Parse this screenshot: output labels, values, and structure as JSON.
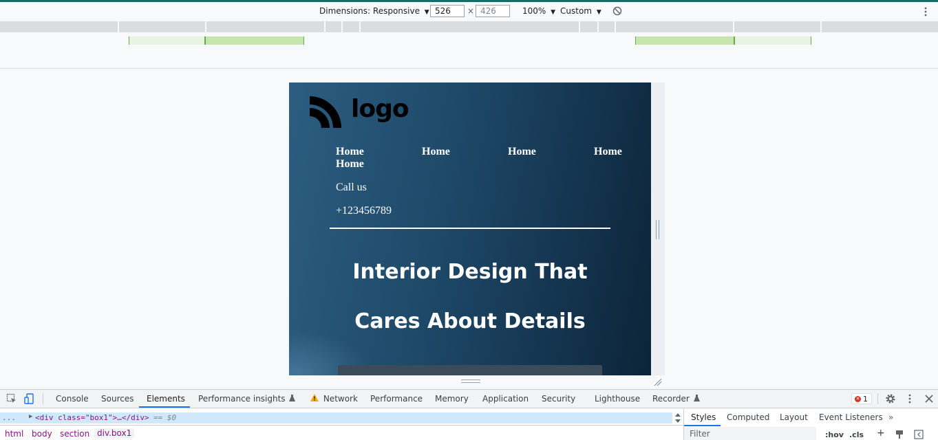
{
  "device_toolbar": {
    "dimensions_label": "Dimensions: Responsive",
    "width_value": "526",
    "height_placeholder": "426",
    "times": "×",
    "zoom_label": "100%",
    "throttle_label": "Custom",
    "dropdown_caret": "▼",
    "more_icon": "kebab-vertical",
    "rotate_icon": "rotate-disabled"
  },
  "site": {
    "logo_text": "logo",
    "nav": [
      "Home",
      "Home",
      "Home",
      "Home",
      "Home"
    ],
    "call_label": "Call us",
    "phone": "+123456789",
    "hero_line1": "Interior Design That",
    "hero_line2": "Cares About Details"
  },
  "devtools": {
    "tabs": [
      "Console",
      "Sources",
      "Elements",
      "Performance insights",
      "Network",
      "Performance",
      "Memory",
      "Application",
      "Security",
      "Lighthouse",
      "Recorder"
    ],
    "active_tab": "Elements",
    "error_count": "1",
    "selected_node": {
      "ellipsis": "...",
      "open": "<div class=\"box1\">…</div>",
      "eq": "== $0"
    },
    "breadcrumbs": [
      "html",
      "body",
      "section",
      "div.box1"
    ],
    "side_tabs": [
      "Styles",
      "Computed",
      "Layout",
      "Event Listeners"
    ],
    "side_more": "»",
    "filter_placeholder": "Filter",
    "side_tools": [
      ":hov",
      ".cls",
      "+"
    ],
    "accent": "#1a73e8"
  }
}
